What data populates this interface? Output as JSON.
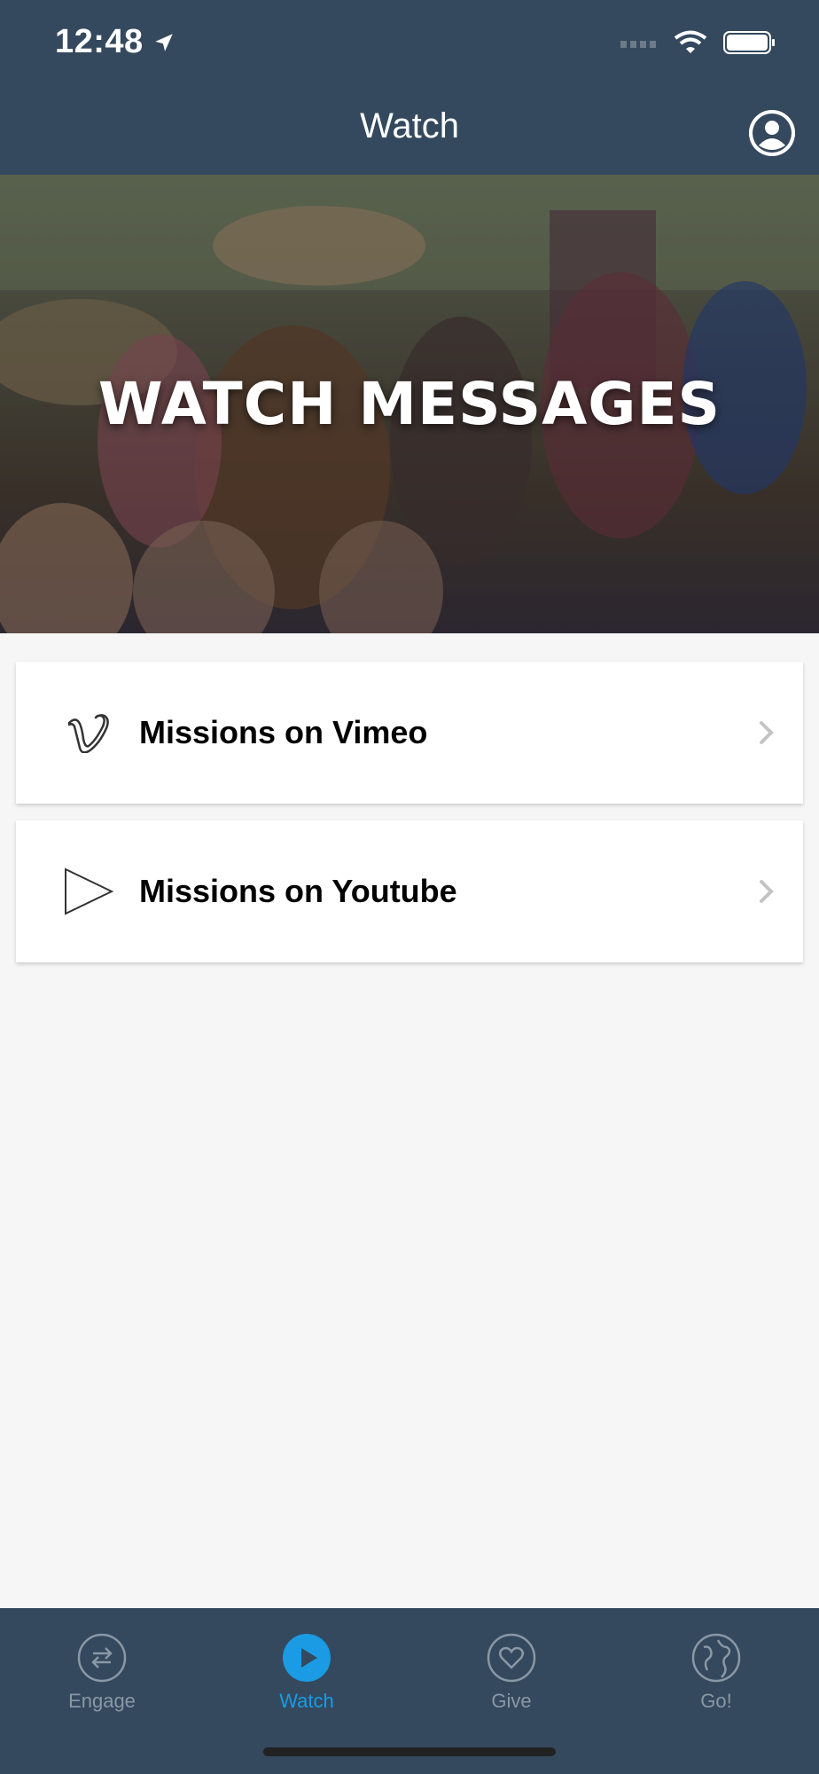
{
  "status_bar": {
    "time": "12:48",
    "icons": [
      "location-arrow-icon",
      "cellular-signal-icon",
      "wifi-icon",
      "battery-icon"
    ]
  },
  "header": {
    "title": "Watch",
    "profile_icon": "user-circle-icon"
  },
  "hero": {
    "title": "WATCH MESSAGES"
  },
  "menu": {
    "items": [
      {
        "label": "Missions on Vimeo",
        "icon": "vimeo-icon"
      },
      {
        "label": "Missions on Youtube",
        "icon": "play-icon"
      }
    ]
  },
  "tabbar": {
    "tabs": [
      {
        "label": "Engage",
        "icon": "swap-arrows-icon",
        "active": false
      },
      {
        "label": "Watch",
        "icon": "play-icon",
        "active": true
      },
      {
        "label": "Give",
        "icon": "heart-icon",
        "active": false
      },
      {
        "label": "Go!",
        "icon": "globe-icon",
        "active": false
      }
    ]
  },
  "colors": {
    "navbar": "#34495e",
    "accent": "#1a9be3",
    "background": "#f6f6f6",
    "inactive_tab": "#8a97a5"
  }
}
